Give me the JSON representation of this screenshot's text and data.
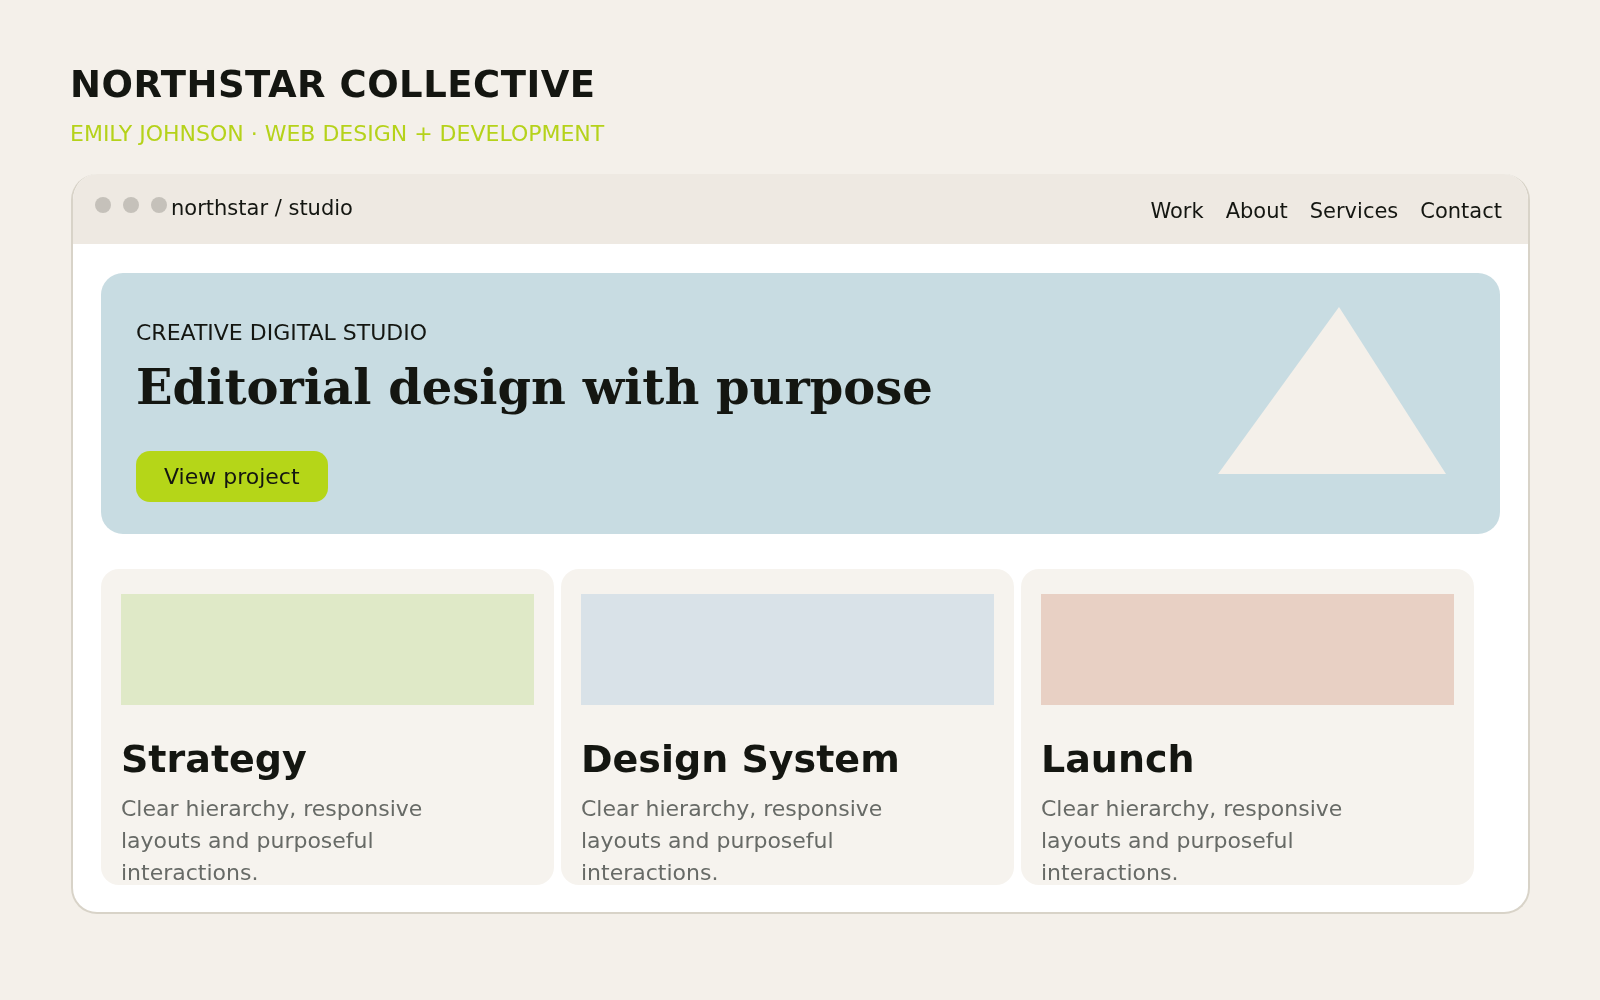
{
  "header": {
    "title": "NORTHSTAR COLLECTIVE",
    "subtitle": "EMILY JOHNSON · WEB DESIGN + DEVELOPMENT"
  },
  "browser": {
    "address": "northstar / studio",
    "nav": [
      "Work",
      "About",
      "Services",
      "Contact"
    ]
  },
  "hero": {
    "eyebrow": "CREATIVE DIGITAL STUDIO",
    "title": "Editorial design with purpose",
    "button": "View project"
  },
  "cards": [
    {
      "title": "Strategy",
      "text": "Clear hierarchy, responsive layouts and purposeful interactions.",
      "color": "#dfe9c7"
    },
    {
      "title": "Design System",
      "text": "Clear hierarchy, responsive layouts and purposeful interactions.",
      "color": "#d9e2e8"
    },
    {
      "title": "Launch",
      "text": "Clear hierarchy, responsive layouts and purposeful interactions.",
      "color": "#e8d0c4"
    }
  ]
}
